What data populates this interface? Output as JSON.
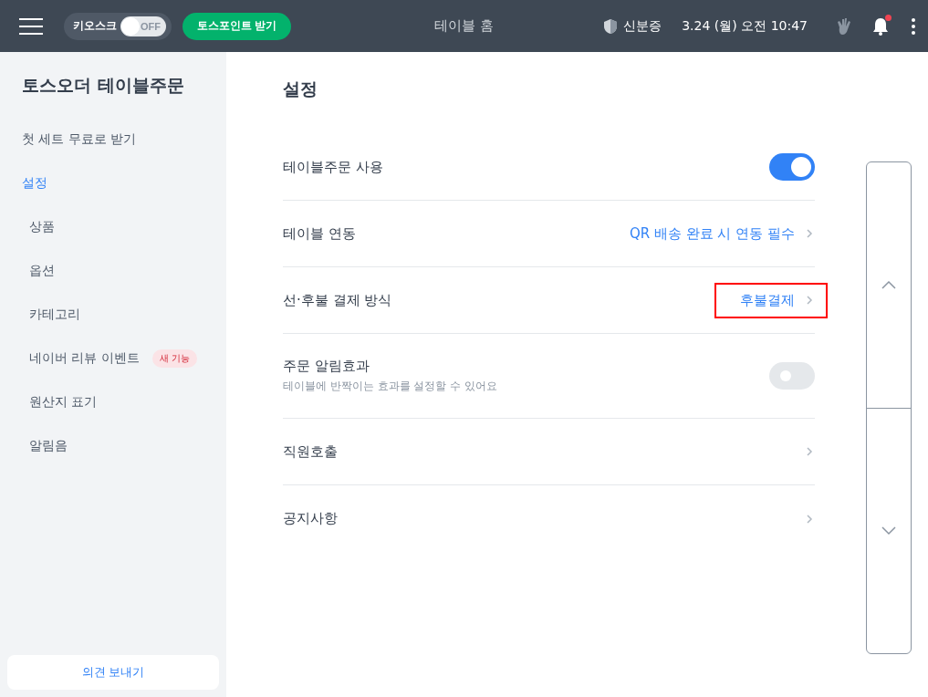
{
  "header": {
    "kiosk": {
      "label": "키오스크",
      "on": false,
      "state_text": "OFF"
    },
    "points_button": "토스포인트 받기",
    "title": "테이블 홈",
    "id_label": "신분증",
    "datetime": "3.24 (월) 오전 10:47",
    "notification_unread": true
  },
  "sidebar": {
    "title": "토스오더 테이블주문",
    "items": [
      {
        "label": "첫 세트 무료로 받기",
        "selected": false
      },
      {
        "label": "설정",
        "selected": true,
        "children": [
          {
            "label": "상품",
            "selected": false
          },
          {
            "label": "옵션",
            "selected": false
          },
          {
            "label": "카테고리",
            "selected": false
          },
          {
            "label": "네이버 리뷰 이벤트",
            "selected": false,
            "badge": "새 기능"
          },
          {
            "label": "원산지 표기",
            "selected": false
          },
          {
            "label": "알림음",
            "selected": false
          }
        ]
      }
    ],
    "feedback_button": "의견 보내기"
  },
  "main": {
    "title": "설정",
    "rows": [
      {
        "kind": "toggle",
        "label": "테이블주문 사용",
        "on": true
      },
      {
        "kind": "link",
        "label": "테이블 연동",
        "value": "QR 배송 완료 시 연동 필수",
        "highlighted": false
      },
      {
        "kind": "link",
        "label": "선·후불 결제 방식",
        "value": "후불결제",
        "highlighted": true
      },
      {
        "kind": "toggle",
        "label": "주문 알림효과",
        "description": "테이블에 반짝이는 효과를 설정할 수 있어요",
        "on": false
      },
      {
        "kind": "link",
        "label": "직원호출"
      },
      {
        "kind": "link",
        "label": "공지사항"
      }
    ]
  }
}
